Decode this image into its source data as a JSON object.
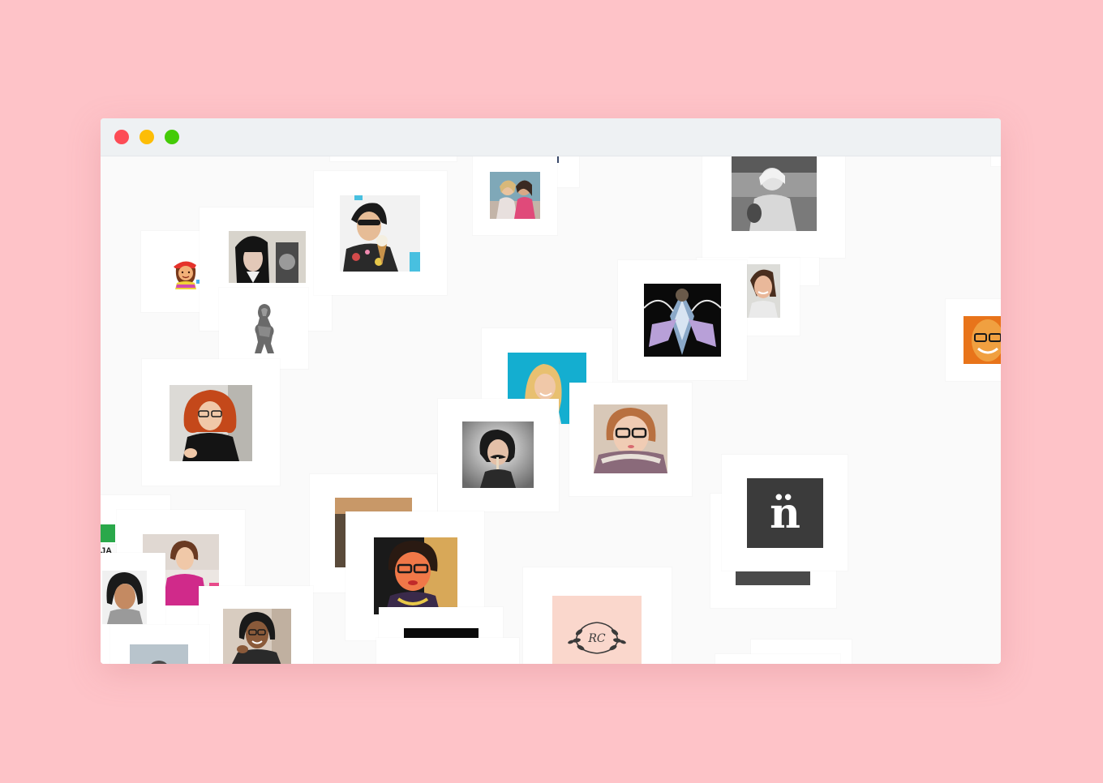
{
  "window": {
    "title_bar": {
      "buttons": [
        "close",
        "minimize",
        "zoom"
      ]
    }
  },
  "gallery": {
    "tiles": [
      {
        "name": "avatar-emoji-girl",
        "kind": "emoji"
      },
      {
        "name": "avatar-woman-bangs",
        "kind": "photo"
      },
      {
        "name": "avatar-woman-icecream",
        "kind": "photo"
      },
      {
        "name": "avatar-two-friends",
        "kind": "photo"
      },
      {
        "name": "avatar-woman-bw-booth",
        "kind": "photo"
      },
      {
        "name": "avatar-sculpture",
        "kind": "photo"
      },
      {
        "name": "avatar-kaleidoscope",
        "kind": "photo"
      },
      {
        "name": "avatar-woman-smiling-side",
        "kind": "photo"
      },
      {
        "name": "avatar-man-orange",
        "kind": "photo"
      },
      {
        "name": "avatar-woman-red-curls",
        "kind": "photo"
      },
      {
        "name": "avatar-woman-blue-bg",
        "kind": "photo"
      },
      {
        "name": "avatar-woman-mustache",
        "kind": "photo"
      },
      {
        "name": "avatar-woman-glasses-scarf",
        "kind": "photo"
      },
      {
        "name": "avatar-logo-n",
        "kind": "logo",
        "glyph": "n̈"
      },
      {
        "name": "avatar-woman-orange-glasses",
        "kind": "photo"
      },
      {
        "name": "avatar-monogram",
        "kind": "logo",
        "glyph": "RC"
      },
      {
        "name": "avatar-woman-pink-shirt",
        "kind": "photo"
      },
      {
        "name": "avatar-woman-curly-hair",
        "kind": "photo"
      },
      {
        "name": "avatar-woman-laughing",
        "kind": "photo"
      },
      {
        "name": "avatar-woman-dark-hair",
        "kind": "photo"
      },
      {
        "name": "avatar-green-logo",
        "kind": "logo",
        "glyph": "JA"
      }
    ]
  },
  "colors": {
    "background": "#fec3c8",
    "window": "#fafafa",
    "titlebar": "#eef1f3",
    "close": "#fd4c56",
    "minimize": "#fdbd06",
    "zoom": "#44cb07"
  }
}
